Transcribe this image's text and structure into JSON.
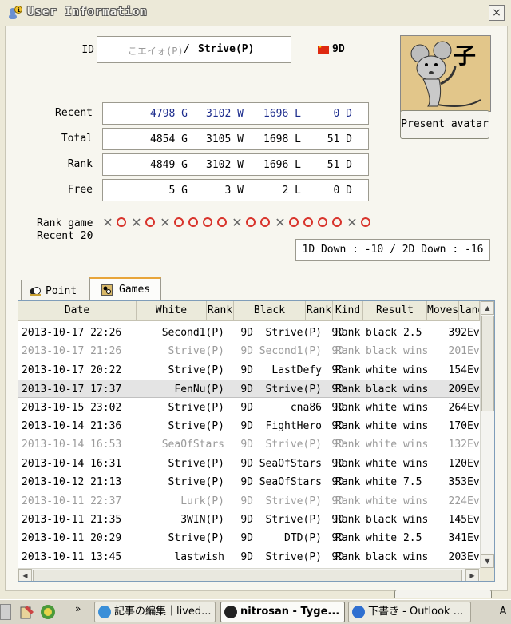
{
  "window": {
    "title": "User Information",
    "close_label": "×"
  },
  "profile": {
    "id_label": "ID",
    "id_prefix": "こエイォ(P)",
    "id_sep": "/",
    "id_main": "Strive(P)",
    "rank": "9D",
    "flag_color": "#de2910",
    "avatar_char": "子",
    "present_avatar": "Present avatar"
  },
  "stats": [
    {
      "label": "Recent",
      "g": "4798 G",
      "w": "3102 W",
      "l": "1696 L",
      "d": "0 D"
    },
    {
      "label": "Total",
      "g": "4854 G",
      "w": "3105 W",
      "l": "1698 L",
      "d": "51 D"
    },
    {
      "label": "Rank",
      "g": "4849 G",
      "w": "3102 W",
      "l": "1696 L",
      "d": "51 D"
    },
    {
      "label": "Free",
      "g": "5 G",
      "w": "3 W",
      "l": "2 L",
      "d": "0 D"
    }
  ],
  "recent20": {
    "label1": "Rank game",
    "label2": "Recent 20",
    "results": [
      "x",
      "o",
      "x",
      "o",
      "x",
      "o",
      "o",
      "o",
      "o",
      "x",
      "o",
      "o",
      "x",
      "o",
      "o",
      "o",
      "o",
      "x",
      "o"
    ],
    "colors": {
      "win": "#d8342c",
      "loss": "#666666"
    }
  },
  "down_info": "1D Down : -10 / 2D Down : -16",
  "tabs": [
    {
      "label": "Point",
      "icon": "point-icon"
    },
    {
      "label": "Games",
      "icon": "games-icon"
    }
  ],
  "table": {
    "headers": [
      "Date",
      "White",
      "Rank",
      "Black",
      "Rank",
      "Kind",
      "Result",
      "Moves",
      "land"
    ],
    "rows": [
      {
        "date": "2013-10-17 22:26",
        "white": "Second1(P)",
        "wrank": "9D",
        "black": "Strive(P)",
        "brank": "9D",
        "kind": "Rank",
        "result": "black 2.5",
        "moves": "392",
        "land": "Ev",
        "dim": false,
        "sel": false
      },
      {
        "date": "2013-10-17 21:26",
        "white": "Strive(P)",
        "wrank": "9D",
        "black": "Second1(P)",
        "brank": "9D",
        "kind": "Rank",
        "result": "black wins",
        "moves": "201",
        "land": "Ev",
        "dim": true,
        "sel": false
      },
      {
        "date": "2013-10-17 20:22",
        "white": "Strive(P)",
        "wrank": "9D",
        "black": "LastDefy",
        "brank": "9D",
        "kind": "Rank",
        "result": "white wins",
        "moves": "154",
        "land": "Ev",
        "dim": false,
        "sel": false
      },
      {
        "date": "2013-10-17 17:37",
        "white": "FenNu(P)",
        "wrank": "9D",
        "black": "Strive(P)",
        "brank": "9D",
        "kind": "Rank",
        "result": "black wins",
        "moves": "209",
        "land": "Ev",
        "dim": false,
        "sel": true
      },
      {
        "date": "2013-10-15 23:02",
        "white": "Strive(P)",
        "wrank": "9D",
        "black": "cna86",
        "brank": "9D",
        "kind": "Rank",
        "result": "white wins",
        "moves": "264",
        "land": "Ev",
        "dim": false,
        "sel": false
      },
      {
        "date": "2013-10-14 21:36",
        "white": "Strive(P)",
        "wrank": "9D",
        "black": "FightHero",
        "brank": "9D",
        "kind": "Rank",
        "result": "white wins",
        "moves": "170",
        "land": "Ev",
        "dim": false,
        "sel": false
      },
      {
        "date": "2013-10-14 16:53",
        "white": "SeaOfStars",
        "wrank": "9D",
        "black": "Strive(P)",
        "brank": "9D",
        "kind": "Rank",
        "result": "white wins",
        "moves": "132",
        "land": "Ev",
        "dim": true,
        "sel": false
      },
      {
        "date": "2013-10-14 16:31",
        "white": "Strive(P)",
        "wrank": "9D",
        "black": "SeaOfStars",
        "brank": "9D",
        "kind": "Rank",
        "result": "white wins",
        "moves": "120",
        "land": "Ev",
        "dim": false,
        "sel": false
      },
      {
        "date": "2013-10-12 21:13",
        "white": "Strive(P)",
        "wrank": "9D",
        "black": "SeaOfStars",
        "brank": "9D",
        "kind": "Rank",
        "result": "white 7.5",
        "moves": "353",
        "land": "Ev",
        "dim": false,
        "sel": false
      },
      {
        "date": "2013-10-11 22:37",
        "white": "Lurk(P)",
        "wrank": "9D",
        "black": "Strive(P)",
        "brank": "9D",
        "kind": "Rank",
        "result": "white wins",
        "moves": "224",
        "land": "Ev",
        "dim": true,
        "sel": false
      },
      {
        "date": "2013-10-11 21:35",
        "white": "3WIN(P)",
        "wrank": "9D",
        "black": "Strive(P)",
        "brank": "9D",
        "kind": "Rank",
        "result": "black wins",
        "moves": "145",
        "land": "Ev",
        "dim": false,
        "sel": false
      },
      {
        "date": "2013-10-11 20:29",
        "white": "Strive(P)",
        "wrank": "9D",
        "black": "DTD(P)",
        "brank": "9D",
        "kind": "Rank",
        "result": "white 2.5",
        "moves": "341",
        "land": "Ev",
        "dim": false,
        "sel": false
      },
      {
        "date": "2013-10-11 13:45",
        "white": "lastwish",
        "wrank": "9D",
        "black": "Strive(P)",
        "brank": "9D",
        "kind": "Rank",
        "result": "black wins",
        "moves": "203",
        "land": "Ev",
        "dim": false,
        "sel": false
      }
    ]
  },
  "taskbar": {
    "chevron": "»",
    "items": [
      {
        "label": "記事の編集｜lived...",
        "icon_color": "#3a8fd8",
        "active": false
      },
      {
        "label": "nitrosan - Tyge...",
        "icon_color": "#222222",
        "active": true
      },
      {
        "label": "下書き - Outlook ...",
        "icon_color": "#2f6fd0",
        "active": false
      }
    ],
    "tray_text": "A"
  }
}
